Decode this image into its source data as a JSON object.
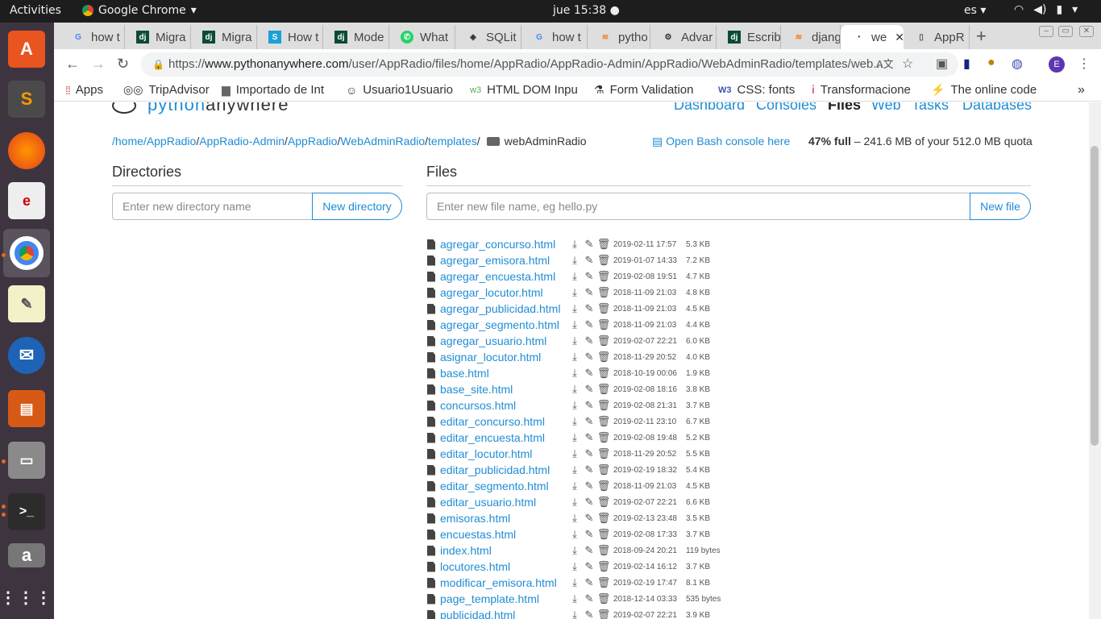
{
  "system": {
    "activities": "Activities",
    "app_name": "Google Chrome",
    "clock": "jue 15:38",
    "lang": "es"
  },
  "tabs": [
    {
      "label": "how t",
      "icon": "google-icon"
    },
    {
      "label": "Migra",
      "icon": "django-icon"
    },
    {
      "label": "Migra",
      "icon": "django-icon"
    },
    {
      "label": "How t",
      "icon": "s-icon"
    },
    {
      "label": "Mode",
      "icon": "django-icon"
    },
    {
      "label": "What",
      "icon": "whatsapp-icon"
    },
    {
      "label": "SQLit",
      "icon": "sqlite-icon"
    },
    {
      "label": "how t",
      "icon": "google-icon"
    },
    {
      "label": "pytho",
      "icon": "stackoverflow-icon"
    },
    {
      "label": "Advar",
      "icon": "advanced-icon"
    },
    {
      "label": "Escrib",
      "icon": "django-icon"
    },
    {
      "label": "djang",
      "icon": "stackoverflow-icon"
    },
    {
      "label": "we",
      "icon": "pythonanywhere-icon"
    },
    {
      "label": "AppR",
      "icon": "page-icon"
    }
  ],
  "url": {
    "prefix": "https://",
    "host": "www.pythonanywhere.com",
    "path": "/user/AppRadio/files/home/AppRadio/AppRadio-Admin/AppRadio/WebAdminRadio/templates/web..."
  },
  "profile_letter": "E",
  "bookmarks": [
    {
      "label": "Apps",
      "icon": "apps-grid-icon"
    },
    {
      "label": "TripAdvisor",
      "icon": "tripadvisor-icon"
    },
    {
      "label": "Importado de Int",
      "icon": "folder-icon"
    },
    {
      "label": "Usuario1Usuario",
      "icon": "smiley-icon"
    },
    {
      "label": "HTML DOM Inpu",
      "icon": "w3-icon"
    },
    {
      "label": "Form Validation",
      "icon": "flask-icon"
    },
    {
      "label": "CSS: fonts",
      "icon": "w3schools-icon"
    },
    {
      "label": "Transformacione",
      "icon": "info-icon"
    },
    {
      "label": "The online code",
      "icon": "bolt-icon"
    }
  ],
  "site": {
    "logo_a": "python",
    "logo_b": "anywhere",
    "nav": [
      "Dashboard",
      "Consoles",
      "Files",
      "Web",
      "Tasks",
      "Databases"
    ],
    "breadcrumb": [
      "/home/",
      "AppRadio",
      "/",
      "AppRadio-Admin",
      "/",
      "AppRadio",
      "/",
      "WebAdminRadio",
      "/",
      "templates",
      "/"
    ],
    "current_folder": "webAdminRadio",
    "bash_link": "Open Bash console here",
    "quota_pct": "47% full",
    "quota_rest": " – 241.6 MB of your 512.0 MB quota",
    "directories_title": "Directories",
    "dir_placeholder": "Enter new directory name",
    "dir_button": "New directory",
    "files_title": "Files",
    "file_placeholder": "Enter new file name, eg hello.py",
    "file_button": "New file"
  },
  "files": [
    {
      "name": "agregar_concurso.html",
      "date": "2019-02-11 17:57",
      "size": "5.3 KB"
    },
    {
      "name": "agregar_emisora.html",
      "date": "2019-01-07 14:33",
      "size": "7.2 KB"
    },
    {
      "name": "agregar_encuesta.html",
      "date": "2019-02-08 19:51",
      "size": "4.7 KB"
    },
    {
      "name": "agregar_locutor.html",
      "date": "2018-11-09 21:03",
      "size": "4.8 KB"
    },
    {
      "name": "agregar_publicidad.html",
      "date": "2018-11-09 21:03",
      "size": "4.5 KB"
    },
    {
      "name": "agregar_segmento.html",
      "date": "2018-11-09 21:03",
      "size": "4.4 KB"
    },
    {
      "name": "agregar_usuario.html",
      "date": "2019-02-07 22:21",
      "size": "6.0 KB"
    },
    {
      "name": "asignar_locutor.html",
      "date": "2018-11-29 20:52",
      "size": "4.0 KB"
    },
    {
      "name": "base.html",
      "date": "2018-10-19 00:06",
      "size": "1.9 KB"
    },
    {
      "name": "base_site.html",
      "date": "2019-02-08 18:16",
      "size": "3.8 KB"
    },
    {
      "name": "concursos.html",
      "date": "2019-02-08 21:31",
      "size": "3.7 KB"
    },
    {
      "name": "editar_concurso.html",
      "date": "2019-02-11 23:10",
      "size": "6.7 KB"
    },
    {
      "name": "editar_encuesta.html",
      "date": "2019-02-08 19:48",
      "size": "5.2 KB"
    },
    {
      "name": "editar_locutor.html",
      "date": "2018-11-29 20:52",
      "size": "5.5 KB"
    },
    {
      "name": "editar_publicidad.html",
      "date": "2019-02-19 18:32",
      "size": "5.4 KB"
    },
    {
      "name": "editar_segmento.html",
      "date": "2018-11-09 21:03",
      "size": "4.5 KB"
    },
    {
      "name": "editar_usuario.html",
      "date": "2019-02-07 22:21",
      "size": "6.6 KB"
    },
    {
      "name": "emisoras.html",
      "date": "2019-02-13 23:48",
      "size": "3.5 KB"
    },
    {
      "name": "encuestas.html",
      "date": "2019-02-08 17:33",
      "size": "3.7 KB"
    },
    {
      "name": "index.html",
      "date": "2018-09-24 20:21",
      "size": "119 bytes"
    },
    {
      "name": "locutores.html",
      "date": "2019-02-14 16:12",
      "size": "3.7 KB"
    },
    {
      "name": "modificar_emisora.html",
      "date": "2019-02-19 17:47",
      "size": "8.1 KB"
    },
    {
      "name": "page_template.html",
      "date": "2018-12-14 03:33",
      "size": "535 bytes"
    },
    {
      "name": "publicidad.html",
      "date": "2019-02-07 22:21",
      "size": "3.9 KB"
    }
  ],
  "colors": {
    "link": "#1f8dd6",
    "launcher": "#3e3440",
    "topbar": "#1d1d1d"
  }
}
